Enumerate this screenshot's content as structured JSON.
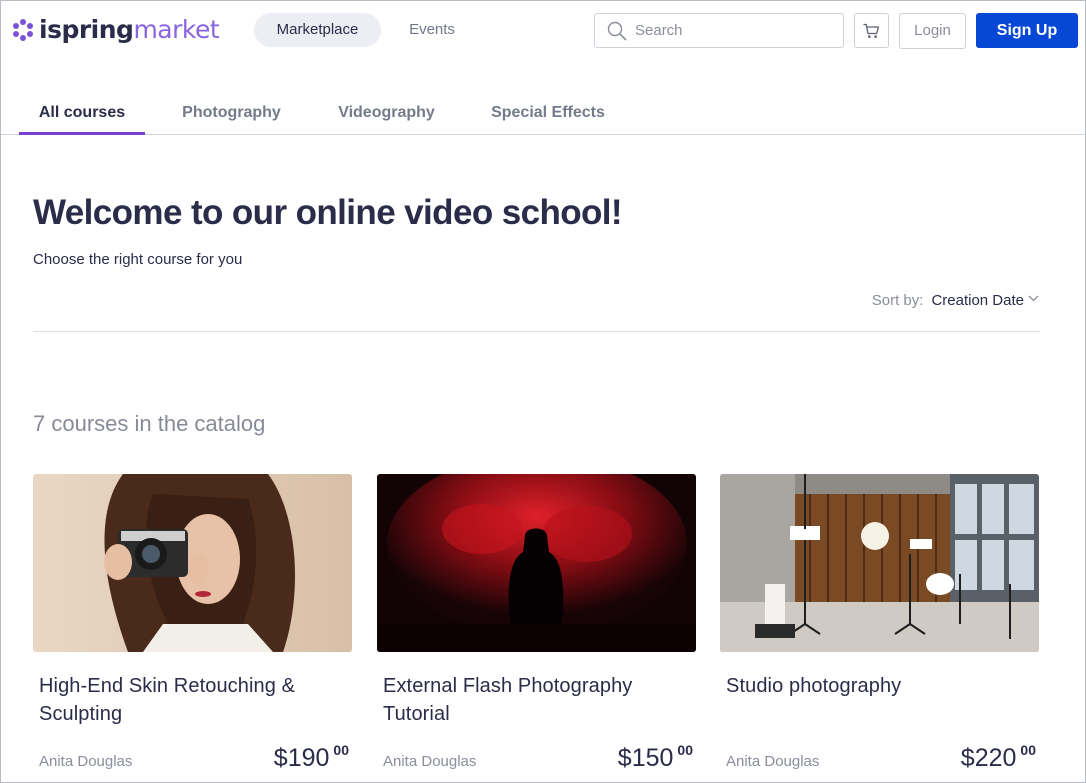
{
  "header": {
    "logo_bold": "ispring",
    "logo_light": "market",
    "nav": [
      {
        "label": "Marketplace",
        "active": true
      },
      {
        "label": "Events",
        "active": false
      }
    ],
    "search": {
      "placeholder": "Search",
      "value": ""
    },
    "cart_icon": "cart-icon",
    "login_label": "Login",
    "signup_label": "Sign Up"
  },
  "tabs": [
    {
      "label": "All courses",
      "active": true
    },
    {
      "label": "Photography",
      "active": false
    },
    {
      "label": "Videography",
      "active": false
    },
    {
      "label": "Special Effects",
      "active": false
    }
  ],
  "hero": {
    "title": "Welcome to our online video school!",
    "subtitle": "Choose the right course for you"
  },
  "sort": {
    "label": "Sort by:",
    "value": "Creation Date"
  },
  "catalog": {
    "count_text": "7 courses in the catalog"
  },
  "courses": [
    {
      "title": "High-End Skin Retouching & Sculpting",
      "author": "Anita Douglas",
      "price_main": "$190",
      "price_cents": "00"
    },
    {
      "title": "External Flash Photography Tutorial",
      "author": "Anita Douglas",
      "price_main": "$150",
      "price_cents": "00"
    },
    {
      "title": "Studio photography",
      "author": "Anita Douglas",
      "price_main": "$220",
      "price_cents": "00"
    }
  ],
  "colors": {
    "brand_purple": "#7b53d6",
    "signup_blue": "#0747d6",
    "active_tab": "#7b3fd0",
    "text_dark": "#2b2c4a",
    "text_muted": "#8a8e9b"
  }
}
